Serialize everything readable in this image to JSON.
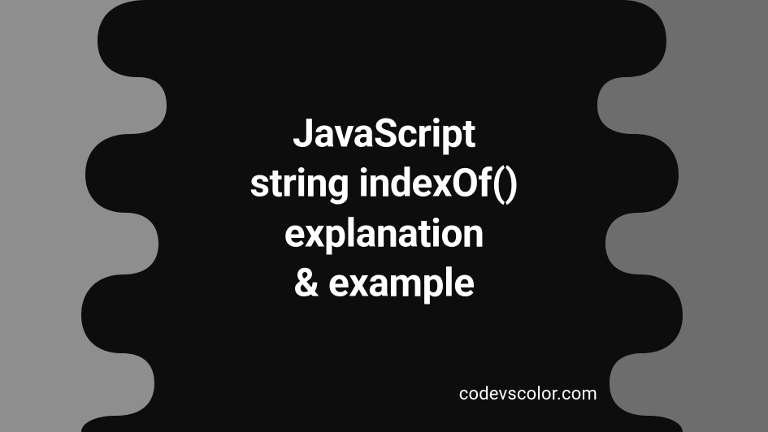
{
  "title": {
    "line1": "JavaScript",
    "line2": "string indexOf()",
    "line3": "explanation",
    "line4": "& example"
  },
  "attribution": "codevscolor.com",
  "colors": {
    "blob": "#0d0d0d",
    "bgLeft": "#8e8e8e",
    "bgRight": "#6d6d6d",
    "text": "#ffffff"
  }
}
